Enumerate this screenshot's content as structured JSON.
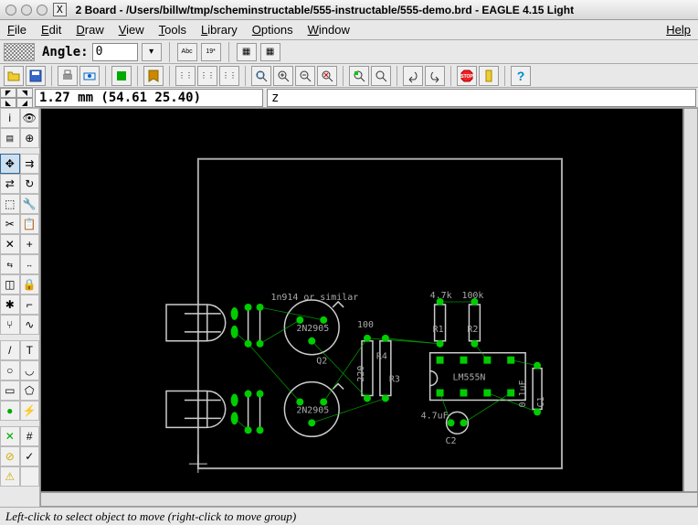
{
  "title": "2 Board - /Users/billw/tmp/scheminstructable/555-instructable/555-demo.brd - EAGLE 4.15 Light",
  "menus": [
    "File",
    "Edit",
    "Draw",
    "View",
    "Tools",
    "Library",
    "Options",
    "Window"
  ],
  "help": "Help",
  "angle": {
    "label": "Angle:",
    "value": "0"
  },
  "coord": "1.27 mm (54.61 25.40)",
  "cmd": "z",
  "status": "Left-click to select object to move (right-click to move group)",
  "components": {
    "d_note": "1n914 or similar",
    "q_label": "2N2905",
    "q2": "Q2",
    "r3_label": "R3",
    "r3_val": "220",
    "r4_label": "R4",
    "r4_val": "100",
    "r1_label": "R1",
    "r1_val": "4.7k",
    "r2_label": "R2",
    "r2_val": "100k",
    "ic": "LM555N",
    "c1_label": "C1",
    "c1_val": "0.1uF",
    "c2_label": "C2",
    "c2_val": "4.7uF"
  }
}
